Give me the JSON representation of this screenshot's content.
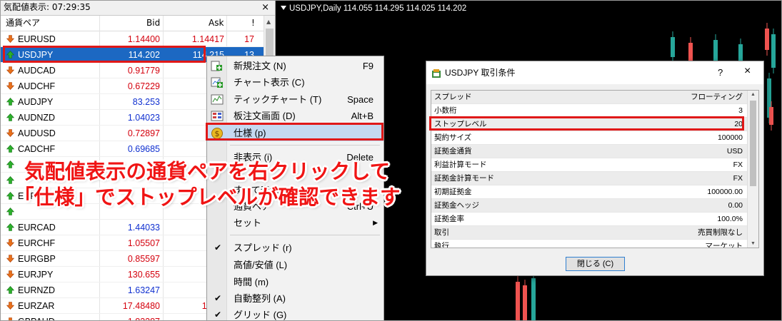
{
  "market_watch": {
    "title": "気配値表示: 07:29:35",
    "close_icon": "×",
    "columns": {
      "symbol": "通貨ペア",
      "bid": "Bid",
      "ask": "Ask",
      "spread": "!"
    },
    "rows": [
      {
        "symbol": "EURUSD",
        "bid": "1.14400",
        "ask": "1.14417",
        "spread": "17",
        "dir": "down",
        "color": "red"
      },
      {
        "symbol": "USDJPY",
        "bid": "114.202",
        "ask": "114.215",
        "spread": "13",
        "dir": "up",
        "color": "blue",
        "selected": true
      },
      {
        "symbol": "AUDCAD",
        "bid": "0.91779",
        "ask": "0.91",
        "spread": "",
        "dir": "down",
        "color": "red"
      },
      {
        "symbol": "AUDCHF",
        "bid": "0.67229",
        "ask": "0.67",
        "spread": "",
        "dir": "down",
        "color": "red"
      },
      {
        "symbol": "AUDJPY",
        "bid": "83.253",
        "ask": "83.",
        "spread": "",
        "dir": "up",
        "color": "blue"
      },
      {
        "symbol": "AUDNZD",
        "bid": "1.04023",
        "ask": "1.04",
        "spread": "",
        "dir": "up",
        "color": "blue"
      },
      {
        "symbol": "AUDUSD",
        "bid": "0.72897",
        "ask": "0.72",
        "spread": "",
        "dir": "down",
        "color": "red"
      },
      {
        "symbol": "CADCHF",
        "bid": "0.69685",
        "ask": "0.69",
        "spread": "",
        "dir": "up",
        "color": "blue"
      },
      {
        "symbol": "",
        "bid": "",
        "ask": "",
        "spread": "",
        "dir": "up",
        "color": "blue"
      },
      {
        "symbol": "",
        "bid": "",
        "ask": "",
        "spread": "",
        "dir": "up",
        "color": "blue"
      },
      {
        "symbol": "EUF",
        "bid": "",
        "ask": "",
        "spread": "",
        "dir": "up",
        "color": "blue"
      },
      {
        "symbol": "",
        "bid": "",
        "ask": "",
        "spread": "",
        "dir": "up",
        "color": "blue"
      },
      {
        "symbol": "EURCAD",
        "bid": "1.44033",
        "ask": "1.44",
        "spread": "",
        "dir": "up",
        "color": "blue"
      },
      {
        "symbol": "EURCHF",
        "bid": "1.05507",
        "ask": "1.05",
        "spread": "",
        "dir": "down",
        "color": "red"
      },
      {
        "symbol": "EURGBP",
        "bid": "0.85597",
        "ask": "0.85",
        "spread": "",
        "dir": "down",
        "color": "red"
      },
      {
        "symbol": "EURJPY",
        "bid": "130.655",
        "ask": "130.",
        "spread": "",
        "dir": "down",
        "color": "red"
      },
      {
        "symbol": "EURNZD",
        "bid": "1.63247",
        "ask": "1.63",
        "spread": "",
        "dir": "up",
        "color": "blue"
      },
      {
        "symbol": "EURZAR",
        "bid": "17.48480",
        "ask": "17.50",
        "spread": "",
        "dir": "down",
        "color": "red"
      },
      {
        "symbol": "GBPAUD",
        "bid": "1.83287",
        "ask": "1.83",
        "spread": "",
        "dir": "down",
        "color": "red"
      }
    ]
  },
  "chart": {
    "title": "USDJPY,Daily  114.055 114.295 114.025 114.202"
  },
  "context_menu": {
    "items": [
      {
        "label": "新規注文 (N)",
        "shortcut": "F9",
        "icon": "new-order-icon"
      },
      {
        "label": "チャート表示 (C)",
        "shortcut": "",
        "icon": "chart-window-icon"
      },
      {
        "label": "ティックチャート (T)",
        "shortcut": "Space",
        "icon": "tick-chart-icon"
      },
      {
        "label": "板注文画面 (D)",
        "shortcut": "Alt+B",
        "icon": "depth-of-market-icon"
      },
      {
        "label": "仕様 (p)",
        "shortcut": "",
        "icon": "specification-icon",
        "highlighted": true
      },
      {
        "label": "非表示 (i)",
        "shortcut": "Delete"
      },
      {
        "label": "",
        "shortcut": ""
      },
      {
        "label": "すべて表示(S)",
        "shortcut": ""
      },
      {
        "label": "通貨ペア",
        "shortcut": "Ctrl+U"
      },
      {
        "label": "セット",
        "shortcut": "",
        "submenu": true
      },
      {
        "label": "スプレッド (r)",
        "checked": true
      },
      {
        "label": "高値/安値 (L)",
        "checked": false
      },
      {
        "label": "時間 (m)",
        "checked": false
      },
      {
        "label": "自動整列 (A)",
        "checked": true
      },
      {
        "label": "グリッド (G)",
        "checked": true
      }
    ]
  },
  "dialog": {
    "title": "USDJPY 取引条件",
    "help": "?",
    "close": "×",
    "properties": [
      {
        "key": "スプレッド",
        "value": "フローティング"
      },
      {
        "key": "小数桁",
        "value": "3"
      },
      {
        "key": "ストップレベル",
        "value": "20"
      },
      {
        "key": "契約サイズ",
        "value": "100000"
      },
      {
        "key": "証拠金通貨",
        "value": "USD"
      },
      {
        "key": "利益計算モード",
        "value": "FX"
      },
      {
        "key": "証拠金計算モード",
        "value": "FX"
      },
      {
        "key": "初期証拠金",
        "value": "100000.00"
      },
      {
        "key": "証拠金ヘッジ",
        "value": "0.00"
      },
      {
        "key": "証拠金率",
        "value": "100.0%"
      },
      {
        "key": "取引",
        "value": "売買制限なし"
      },
      {
        "key": "執行",
        "value": "マーケット"
      }
    ],
    "close_button": "閉じる (C)"
  },
  "annotation": {
    "line1": "気配値表示の通貨ペアを右クリックして",
    "line2": "「仕様」でストップレベルが確認できます"
  },
  "colors": {
    "bid_up": "#1030d0",
    "bid_down": "#d4000d",
    "selection": "#1c68c2",
    "highlight_box": "#e01818",
    "candle_up": "#26a69a",
    "candle_down": "#ef5350"
  }
}
